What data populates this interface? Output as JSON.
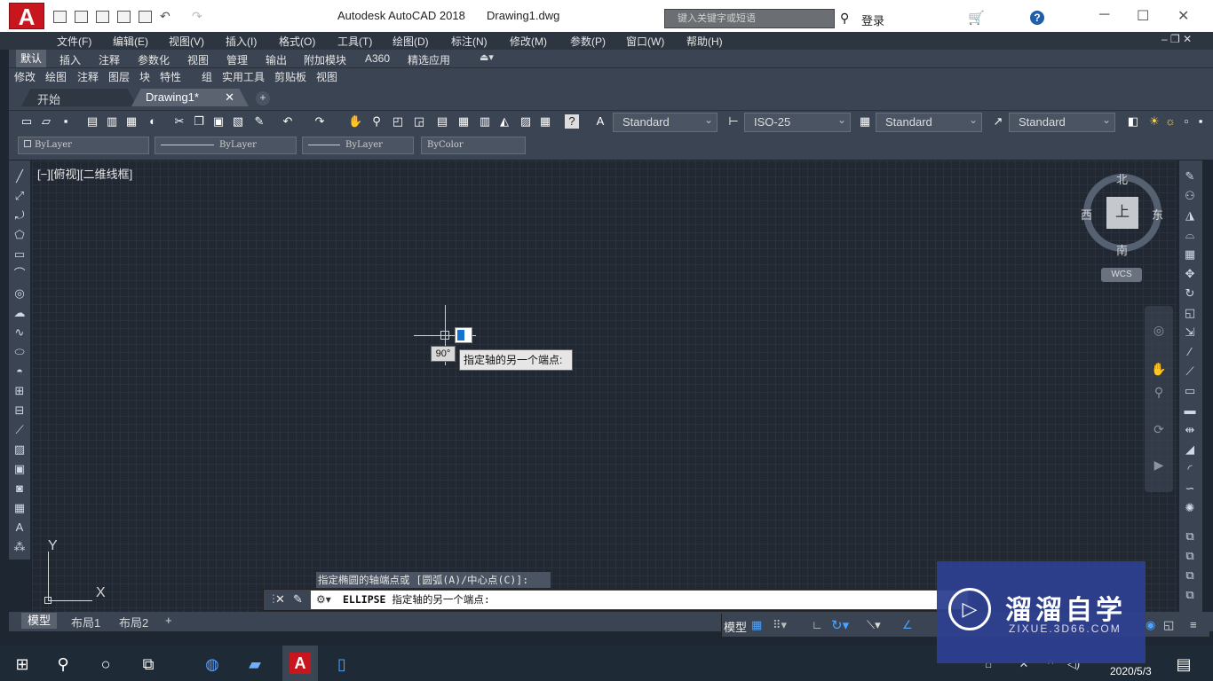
{
  "app": {
    "title": "Autodesk AutoCAD 2018",
    "filename": "Drawing1.dwg",
    "logo": "A"
  },
  "search": {
    "placeholder": "键入关键字或短语"
  },
  "user": {
    "login": "登录"
  },
  "menus": [
    "文件(F)",
    "编辑(E)",
    "视图(V)",
    "插入(I)",
    "格式(O)",
    "工具(T)",
    "绘图(D)",
    "标注(N)",
    "修改(M)",
    "参数(P)",
    "窗口(W)",
    "帮助(H)"
  ],
  "ribbon_tabs": [
    "默认",
    "插入",
    "注释",
    "参数化",
    "视图",
    "管理",
    "输出",
    "附加模块",
    "A360",
    "精选应用"
  ],
  "panels": [
    "修改",
    "绘图",
    "注释",
    "图层",
    "块",
    "特性",
    "组",
    "实用工具",
    "剪贴板",
    "视图"
  ],
  "doc_tabs": {
    "start": "开始",
    "drawing": "Drawing1*",
    "add": "+"
  },
  "styles": {
    "text": "Standard",
    "dim": "ISO-25",
    "table": "Standard",
    "mleader": "Standard"
  },
  "props": {
    "layer": "ByLayer",
    "linetype": "ByLayer",
    "lineweight": "ByLayer",
    "color": "ByColor"
  },
  "viewport": {
    "label": "[−][俯视][二维线框]"
  },
  "viewcube": {
    "face": "上",
    "north": "北",
    "south": "南",
    "east": "东",
    "west": "西",
    "wcs": "WCS"
  },
  "dynamic": {
    "angle": "90°",
    "prompt": "指定轴的另一个端点:"
  },
  "ucs": {
    "x": "X",
    "y": "Y"
  },
  "command": {
    "history": "指定椭圆的轴端点或 [圆弧(A)/中心点(C)]:",
    "name": "ELLIPSE",
    "prompt": "指定轴的另一个端点:"
  },
  "layout_tabs": {
    "model": "模型",
    "layout1": "布局1",
    "layout2": "布局2",
    "add": "+"
  },
  "status": {
    "model": "模型"
  },
  "watermark": {
    "text": "溜溜自学",
    "sub": "ZIXUE.3D66.COM"
  },
  "taskbar": {
    "date": "2020/5/3"
  },
  "colors": {
    "accent": "#c8161e",
    "bg": "#212832"
  }
}
